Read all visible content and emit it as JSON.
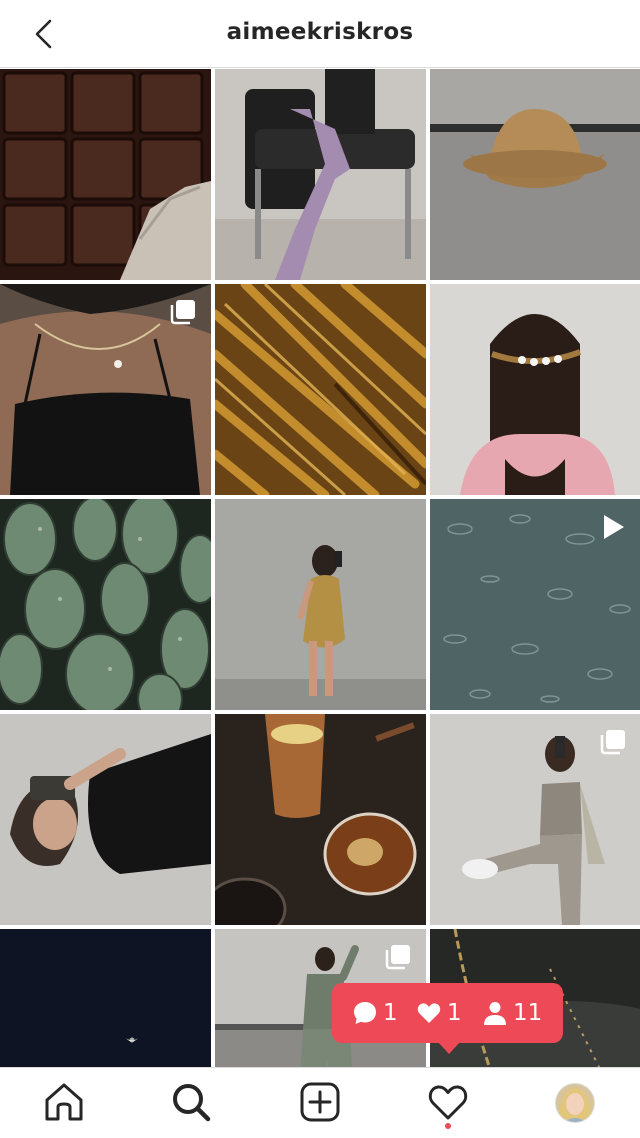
{
  "header": {
    "username": "aimeekriskros"
  },
  "icons": {
    "back": "chevron-left-icon",
    "multi": "multiple-posts-icon",
    "video": "play-icon",
    "home": "home-icon",
    "search": "search-icon",
    "add": "add-post-icon",
    "activity": "heart-icon",
    "profile": "profile-avatar"
  },
  "grid": {
    "posts": [
      {
        "subject": "chocolate bar",
        "badge": ""
      },
      {
        "subject": "woman on leather chair",
        "badge": ""
      },
      {
        "subject": "bucket hat",
        "badge": ""
      },
      {
        "subject": "black top necklace",
        "badge": "multi"
      },
      {
        "subject": "golden palm leaf",
        "badge": ""
      },
      {
        "subject": "hair clip",
        "badge": ""
      },
      {
        "subject": "cactus",
        "badge": ""
      },
      {
        "subject": "mustard dress mirror selfie",
        "badge": ""
      },
      {
        "subject": "rain on water",
        "badge": "video"
      },
      {
        "subject": "lying selfie",
        "badge": ""
      },
      {
        "subject": "drinks on table",
        "badge": ""
      },
      {
        "subject": "activewear pose",
        "badge": "multi"
      },
      {
        "subject": "moon night sky",
        "badge": ""
      },
      {
        "subject": "sage tracksuit",
        "badge": "multi"
      },
      {
        "subject": "chain necklace",
        "badge": ""
      }
    ]
  },
  "notification": {
    "comments": "1",
    "likes": "1",
    "follows": "11"
  },
  "colors": {
    "accent": "#ed4956",
    "text": "#262626",
    "divider": "#dbdbdb"
  }
}
